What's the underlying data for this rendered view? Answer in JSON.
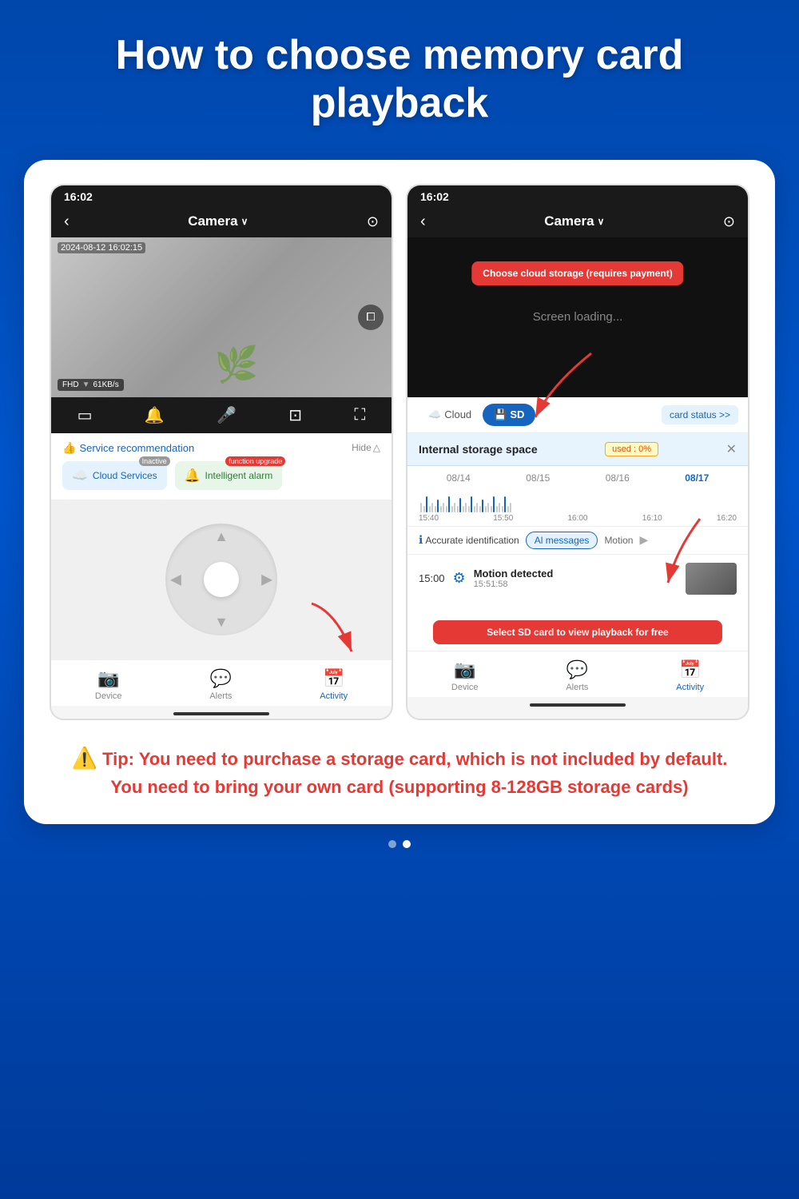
{
  "title": "How to choose memory card playback",
  "phones": {
    "left": {
      "time": "16:02",
      "nav_title": "Camera",
      "camera_timestamp": "2024-08-12 16:02:15",
      "fhd_label": "FHD",
      "speed_label": "61KB/s",
      "service_title": "Service recommendation",
      "hide_label": "Hide",
      "cloud_btn": "Cloud Services",
      "cloud_badge": "Inactive",
      "alarm_btn": "Intelligent alarm",
      "alarm_badge": "function upgrade",
      "nav_items": [
        {
          "label": "Device",
          "icon": "📷"
        },
        {
          "label": "Alerts",
          "icon": "💬"
        },
        {
          "label": "Activity",
          "icon": "📅"
        }
      ],
      "arrow_label": "Activity",
      "ptz_arrows": [
        "▲",
        "▼",
        "◀",
        "▶"
      ]
    },
    "right": {
      "time": "16:02",
      "nav_title": "Camera",
      "screen_loading": "Screen loading...",
      "callout_cloud": "Choose cloud storage (requires payment)",
      "callout_sd": "Select SD card to view playback for free",
      "tab_cloud": "Cloud",
      "tab_sd": "SD",
      "card_status": "card status >>",
      "storage_title": "Internal storage space",
      "used_label": "used : 0%",
      "dates": [
        "08/14",
        "08/15",
        "08/16",
        "08/17"
      ],
      "times": [
        "15:40",
        "15:50",
        "16:00",
        "16:10",
        "16:20"
      ],
      "accurate_label": "Accurate identification",
      "filter_messages": "Al messages",
      "filter_motion": "Motion",
      "event_time": "15:00",
      "event_title": "Motion detected",
      "event_sub": "15:51:58",
      "nav_items": [
        {
          "label": "Device",
          "icon": "📷"
        },
        {
          "label": "Alerts",
          "icon": "💬"
        },
        {
          "label": "Activity",
          "icon": "📅"
        }
      ]
    }
  },
  "tip": {
    "icon": "⚠️",
    "text": "Tip: You need to purchase a storage card, which is not included by default. You need to bring your own card (supporting 8-128GB storage cards)"
  },
  "pagination": {
    "dots": [
      false,
      true
    ]
  }
}
